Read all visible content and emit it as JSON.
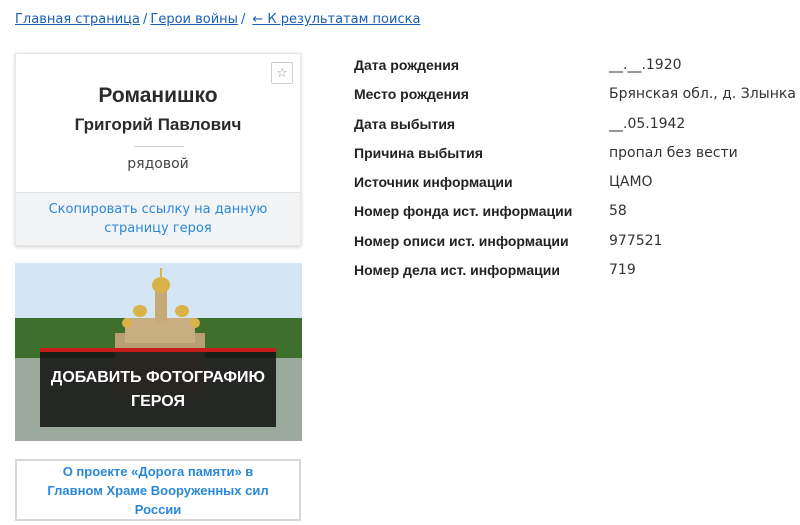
{
  "breadcrumb": {
    "home": "Главная страница",
    "heroes": "Герои войны",
    "separator": "/",
    "back": "← К результатам поиска"
  },
  "hero": {
    "surname": "Романишко",
    "names": "Григорий Павлович",
    "rank": "рядовой",
    "favorite_icon": "☆",
    "copy_link": "Скопировать ссылку на данную страницу героя"
  },
  "photo": {
    "add_line1": "ДОБАВИТЬ ФОТОГРАФИЮ",
    "add_line2": "ГЕРОЯ"
  },
  "project": {
    "label": "О проекте «Дорога памяти» в Главном Храме Вооруженных сил России"
  },
  "info": [
    {
      "label": "Дата рождения",
      "value": "__.__.1920"
    },
    {
      "label": "Место рождения",
      "value": "Брянская обл., д. Злынка"
    },
    {
      "label": "Дата выбытия",
      "value": "__.05.1942"
    },
    {
      "label": "Причина выбытия",
      "value": "пропал без вести"
    },
    {
      "label": "Источник информации",
      "value": "ЦАМО"
    },
    {
      "label": "Номер фонда ист. информации",
      "value": "58"
    },
    {
      "label": "Номер описи ист. информации",
      "value": "977521"
    },
    {
      "label": "Номер дела ист. информации",
      "value": "719"
    }
  ],
  "colors": {
    "link": "#2a88d8",
    "breadcrumb": "#1a5fb4",
    "overlay_accent": "#c81d1d"
  }
}
